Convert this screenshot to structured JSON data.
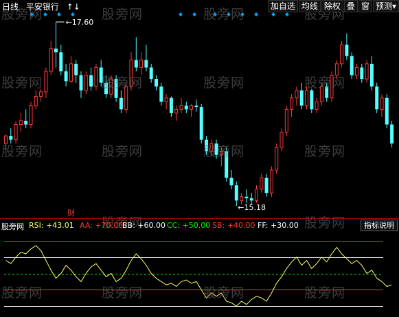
{
  "header": {
    "period": "日线",
    "stock_name": "平安银行",
    "arrows": "↑↓"
  },
  "menu": {
    "items": [
      {
        "label": "加自选"
      },
      {
        "label": "均线"
      },
      {
        "label": "除权"
      },
      {
        "label": "叠"
      },
      {
        "label": "窗"
      },
      {
        "label": "预测"
      }
    ],
    "menu_arrow": "▾"
  },
  "price_labels": {
    "high": "17.60",
    "low": "15.18"
  },
  "finance_marker": "财",
  "indicator": {
    "name_label": "股旁网",
    "rsi": "RSI: +43.01",
    "aa": "AA: +70.00",
    "bb": "BB: +60.00",
    "cc": "CC: +50.00",
    "sb": "SB: +40.00",
    "ff": "FF: +30.00",
    "help_button": "指标说明",
    "levels": [
      70,
      60,
      50,
      40,
      30
    ]
  },
  "watermark": "股旁网",
  "colors": {
    "up": "#ff3a3a",
    "down": "#54ffff",
    "rsi": "#ffff66",
    "aa": "#ff3a3a",
    "bb": "#ffffff",
    "cc": "#00ff00",
    "sb": "#ff3a3a",
    "ff": "#ffffff",
    "diamond": "#00a0ff"
  },
  "candles": [
    [
      16.0,
      16.12,
      15.92,
      16.1
    ],
    [
      16.1,
      16.2,
      16.0,
      16.05
    ],
    [
      16.05,
      16.3,
      16.0,
      16.25
    ],
    [
      16.25,
      16.4,
      16.15,
      16.3
    ],
    [
      16.3,
      16.45,
      16.2,
      16.25
    ],
    [
      16.25,
      16.55,
      16.2,
      16.5
    ],
    [
      16.5,
      16.7,
      16.45,
      16.62
    ],
    [
      16.62,
      16.72,
      16.55,
      16.68
    ],
    [
      16.68,
      17.0,
      16.6,
      16.95
    ],
    [
      16.95,
      17.35,
      16.9,
      17.25
    ],
    [
      17.25,
      17.6,
      17.0,
      17.2
    ],
    [
      17.2,
      17.3,
      16.9,
      16.95
    ],
    [
      16.95,
      17.05,
      16.75,
      16.82
    ],
    [
      16.82,
      17.15,
      16.8,
      17.05
    ],
    [
      17.05,
      17.1,
      16.8,
      16.9
    ],
    [
      16.9,
      16.95,
      16.6,
      16.7
    ],
    [
      16.7,
      16.95,
      16.65,
      16.9
    ],
    [
      16.9,
      17.0,
      16.7,
      16.75
    ],
    [
      16.75,
      17.05,
      16.7,
      17.0
    ],
    [
      17.0,
      17.1,
      16.75,
      16.8
    ],
    [
      16.8,
      16.9,
      16.6,
      16.65
    ],
    [
      16.65,
      16.9,
      16.6,
      16.85
    ],
    [
      16.85,
      16.9,
      16.55,
      16.6
    ],
    [
      16.6,
      16.7,
      16.4,
      16.45
    ],
    [
      16.45,
      16.8,
      16.4,
      16.75
    ],
    [
      16.75,
      17.2,
      16.7,
      17.1
    ],
    [
      17.1,
      17.4,
      16.95,
      17.0
    ],
    [
      17.0,
      17.2,
      16.9,
      17.1
    ],
    [
      17.1,
      17.3,
      16.95,
      17.0
    ],
    [
      17.0,
      17.05,
      16.8,
      16.85
    ],
    [
      16.85,
      16.9,
      16.7,
      16.75
    ],
    [
      16.75,
      16.8,
      16.5,
      16.55
    ],
    [
      16.55,
      16.65,
      16.45,
      16.6
    ],
    [
      16.6,
      16.62,
      16.35,
      16.4
    ],
    [
      16.4,
      16.5,
      16.3,
      16.45
    ],
    [
      16.45,
      16.6,
      16.4,
      16.5
    ],
    [
      16.5,
      16.55,
      16.4,
      16.45
    ],
    [
      16.45,
      16.52,
      16.35,
      16.5
    ],
    [
      16.5,
      16.58,
      16.42,
      16.48
    ],
    [
      16.48,
      16.52,
      16.0,
      16.05
    ],
    [
      16.05,
      16.1,
      15.85,
      15.9
    ],
    [
      15.9,
      16.05,
      15.85,
      16.0
    ],
    [
      16.0,
      16.05,
      15.8,
      15.85
    ],
    [
      15.85,
      15.95,
      15.7,
      15.9
    ],
    [
      15.9,
      15.95,
      15.5,
      15.55
    ],
    [
      15.55,
      15.65,
      15.4,
      15.45
    ],
    [
      15.45,
      15.5,
      15.18,
      15.25
    ],
    [
      15.25,
      15.35,
      15.2,
      15.3
    ],
    [
      15.3,
      15.4,
      15.22,
      15.28
    ],
    [
      15.28,
      15.35,
      15.2,
      15.25
    ],
    [
      15.25,
      15.45,
      15.22,
      15.4
    ],
    [
      15.4,
      15.6,
      15.35,
      15.55
    ],
    [
      15.55,
      15.6,
      15.3,
      15.35
    ],
    [
      15.35,
      15.7,
      15.3,
      15.65
    ],
    [
      15.65,
      16.0,
      15.6,
      15.95
    ],
    [
      15.95,
      16.2,
      15.9,
      16.15
    ],
    [
      16.15,
      16.5,
      16.1,
      16.45
    ],
    [
      16.45,
      16.65,
      16.35,
      16.6
    ],
    [
      16.6,
      16.75,
      16.5,
      16.7
    ],
    [
      16.7,
      16.8,
      16.45,
      16.5
    ],
    [
      16.5,
      16.75,
      16.45,
      16.7
    ],
    [
      16.7,
      16.72,
      16.4,
      16.45
    ],
    [
      16.45,
      16.6,
      16.4,
      16.55
    ],
    [
      16.55,
      16.8,
      16.5,
      16.75
    ],
    [
      16.75,
      16.8,
      16.55,
      16.6
    ],
    [
      16.6,
      16.95,
      16.55,
      16.9
    ],
    [
      16.9,
      17.1,
      16.85,
      17.05
    ],
    [
      17.05,
      17.35,
      17.0,
      17.3
    ],
    [
      17.3,
      17.45,
      17.1,
      17.15
    ],
    [
      17.15,
      17.2,
      16.85,
      16.9
    ],
    [
      16.9,
      17.05,
      16.85,
      17.0
    ],
    [
      17.0,
      17.05,
      16.8,
      16.85
    ],
    [
      16.85,
      17.1,
      16.8,
      17.05
    ],
    [
      17.05,
      17.15,
      16.7,
      16.75
    ],
    [
      16.75,
      16.8,
      16.4,
      16.45
    ],
    [
      16.45,
      16.65,
      16.35,
      16.6
    ],
    [
      16.6,
      16.65,
      16.2,
      16.25
    ],
    [
      16.25,
      16.3,
      15.95,
      16.0
    ]
  ],
  "rsi_values": [
    58,
    56,
    60,
    63,
    62,
    65,
    67,
    64,
    58,
    52,
    47,
    50,
    55,
    52,
    48,
    45,
    50,
    54,
    56,
    52,
    48,
    50,
    45,
    47,
    52,
    58,
    62,
    59,
    55,
    50,
    47,
    45,
    43,
    44,
    42,
    45,
    46,
    44,
    45,
    40,
    35,
    38,
    36,
    38,
    33,
    32,
    30,
    33,
    31,
    34,
    36,
    35,
    33,
    38,
    44,
    48,
    53,
    57,
    60,
    55,
    58,
    53,
    56,
    60,
    57,
    62,
    66,
    62,
    59,
    56,
    58,
    55,
    50,
    52,
    47,
    45,
    42,
    43
  ]
}
